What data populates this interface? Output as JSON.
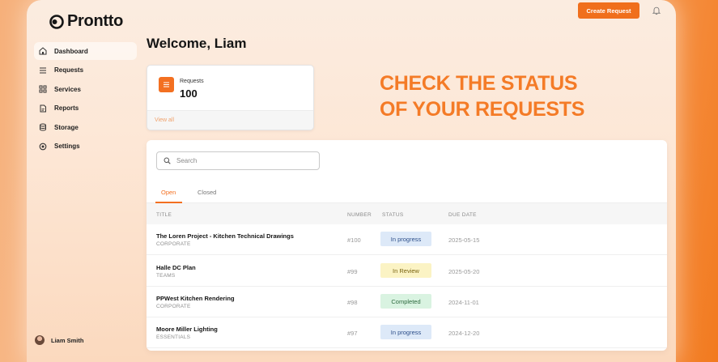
{
  "app": {
    "name": "Prontto"
  },
  "header": {
    "create_label": "Create Request",
    "bell_icon": "bell-icon"
  },
  "sidebar": {
    "items": [
      {
        "label": "Dashboard",
        "icon": "home-icon",
        "active": true
      },
      {
        "label": "Requests",
        "icon": "list-icon",
        "active": false
      },
      {
        "label": "Services",
        "icon": "grid-icon",
        "active": false
      },
      {
        "label": "Reports",
        "icon": "document-icon",
        "active": false
      },
      {
        "label": "Storage",
        "icon": "database-icon",
        "active": false
      },
      {
        "label": "Settings",
        "icon": "gear-icon",
        "active": false
      }
    ]
  },
  "user": {
    "name": "Liam Smith"
  },
  "main": {
    "welcome": "Welcome, Liam",
    "requests_card": {
      "label": "Requests",
      "count": "100",
      "view_all": "View all"
    },
    "promo": {
      "line1": "CHECK THE STATUS",
      "line2": "OF YOUR REQUESTS"
    },
    "search": {
      "placeholder": "Search",
      "value": ""
    },
    "tabs": [
      {
        "label": "Open",
        "active": true
      },
      {
        "label": "Closed",
        "active": false
      }
    ],
    "table": {
      "columns": {
        "title": "TITLE",
        "number": "NUMBER",
        "status": "STATUS",
        "due": "DUE DATE"
      },
      "rows": [
        {
          "title": "The Loren Project - Kitchen Technical Drawings",
          "category": "CORPORATE",
          "number": "#100",
          "status": "In progress",
          "due": "2025-05-15"
        },
        {
          "title": "Halle DC Plan",
          "category": "TEAMS",
          "number": "#99",
          "status": "In Review",
          "due": "2025-05-20"
        },
        {
          "title": "PPWest Kitchen Rendering",
          "category": "CORPORATE",
          "number": "#98",
          "status": "Completed",
          "due": "2024-11-01"
        },
        {
          "title": "Moore Miller Lighting",
          "category": "ESSENTIALS",
          "number": "#97",
          "status": "In progress",
          "due": "2024-12-20"
        }
      ]
    }
  },
  "colors": {
    "accent": "#f37021",
    "status_in_progress": "#dde9f8",
    "status_in_review": "#fbf3c4",
    "status_completed": "#d9f3e1"
  }
}
